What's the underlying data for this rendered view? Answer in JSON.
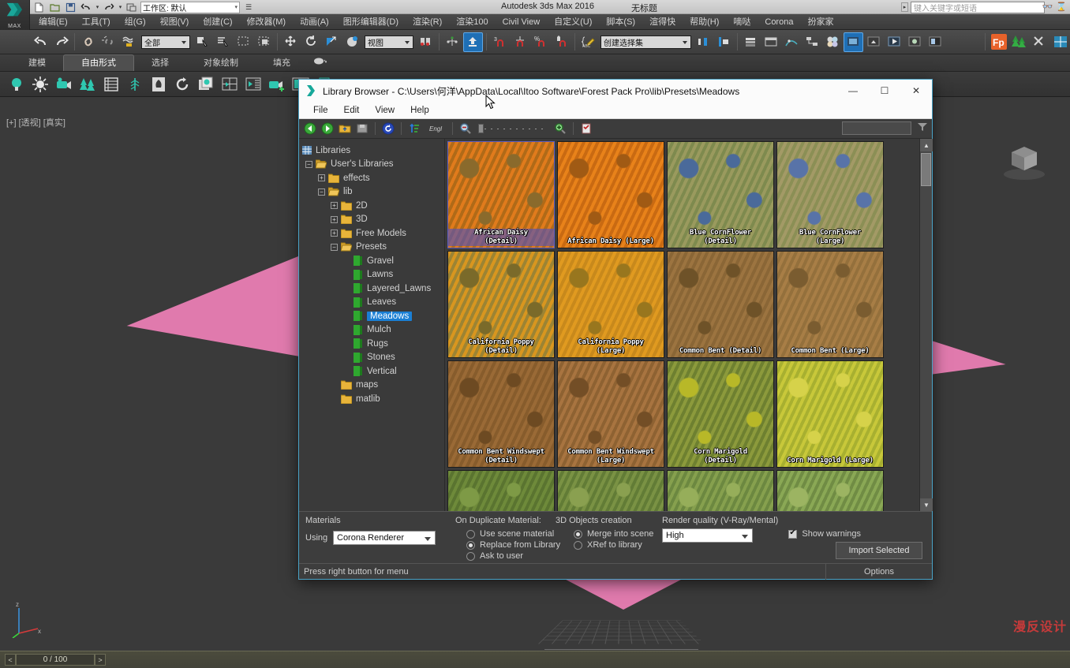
{
  "max": {
    "title": "Autodesk 3ds Max 2016",
    "document": "无标题",
    "workspace_label": "工作区: 默认",
    "search_placeholder": "键入关键字或短语",
    "menus": [
      "编辑(E)",
      "工具(T)",
      "组(G)",
      "视图(V)",
      "创建(C)",
      "修改器(M)",
      "动画(A)",
      "图形编辑器(D)",
      "渲染(R)",
      "渲染100",
      "Civil View",
      "自定义(U)",
      "脚本(S)",
      "渲得快",
      "帮助(H)",
      "嘀哒",
      "Corona",
      "扮家家"
    ],
    "toolbar_selection_filter": "全部",
    "toolbar_ref_coord": "视图",
    "toolbar_named_set": "创建选择集",
    "ribbon_tabs": [
      "建模",
      "自由形式",
      "选择",
      "对象绘制",
      "填充"
    ],
    "ribbon_selected": "自由形式",
    "viewport_label": "[+] [透视] [真实]",
    "frame_counter": "0 / 100",
    "prev_frame": "<",
    "next_frame": ">",
    "watermark": "漫反设计",
    "logo_text": "MAX",
    "axis_labels": {
      "z": "z",
      "x": "x",
      "y": "y"
    }
  },
  "library_browser": {
    "title": "Library Browser - C:\\Users\\何洋\\AppData\\Local\\Itoo Software\\Forest Pack Pro\\lib\\Presets\\Meadows",
    "window_buttons": {
      "minimize": "—",
      "maximize": "☐",
      "close": "✕"
    },
    "menus": [
      "File",
      "Edit",
      "View",
      "Help"
    ],
    "toolbar_icons": [
      "back-icon",
      "forward-icon",
      "folder-up-icon",
      "save-icon",
      "refresh-icon",
      "sort-icon",
      "language-icon",
      "zoom-out-icon",
      "zoom-slider",
      "zoom-in-icon",
      "checklist-icon"
    ],
    "language_badge": "Engl",
    "filter_value": "",
    "tree": {
      "root": "Libraries",
      "items": [
        {
          "label": "User's Libraries",
          "indent": 0,
          "expander": "-",
          "icon": "folder-open-icon"
        },
        {
          "label": "effects",
          "indent": 1,
          "expander": "+",
          "icon": "folder-icon"
        },
        {
          "label": "lib",
          "indent": 1,
          "expander": "-",
          "icon": "folder-open-icon"
        },
        {
          "label": "2D",
          "indent": 2,
          "expander": "+",
          "icon": "folder-icon"
        },
        {
          "label": "3D",
          "indent": 2,
          "expander": "+",
          "icon": "folder-icon"
        },
        {
          "label": "Free Models",
          "indent": 2,
          "expander": "+",
          "icon": "folder-icon"
        },
        {
          "label": "Presets",
          "indent": 2,
          "expander": "-",
          "icon": "folder-open-icon"
        },
        {
          "label": "Gravel",
          "indent": 3,
          "expander": "",
          "icon": "green-item-icon"
        },
        {
          "label": "Lawns",
          "indent": 3,
          "expander": "",
          "icon": "green-item-icon"
        },
        {
          "label": "Layered_Lawns",
          "indent": 3,
          "expander": "",
          "icon": "green-item-icon"
        },
        {
          "label": "Leaves",
          "indent": 3,
          "expander": "",
          "icon": "green-item-icon"
        },
        {
          "label": "Meadows",
          "indent": 3,
          "expander": "",
          "icon": "green-item-icon",
          "selected": true
        },
        {
          "label": "Mulch",
          "indent": 3,
          "expander": "",
          "icon": "green-item-icon"
        },
        {
          "label": "Rugs",
          "indent": 3,
          "expander": "",
          "icon": "green-item-icon"
        },
        {
          "label": "Stones",
          "indent": 3,
          "expander": "",
          "icon": "green-item-icon"
        },
        {
          "label": "Vertical",
          "indent": 3,
          "expander": "",
          "icon": "green-item-icon"
        },
        {
          "label": "maps",
          "indent": 2,
          "expander": "",
          "icon": "folder-icon"
        },
        {
          "label": "matlib",
          "indent": 2,
          "expander": "",
          "icon": "folder-icon"
        }
      ]
    },
    "thumbnails": [
      {
        "label": "African Daisy\n(Detail)",
        "c1": "#e07b1c",
        "c2": "#b06a18",
        "c3": "#8a6a2c",
        "selected": true
      },
      {
        "label": "African Daisy (Large)",
        "c1": "#e8821a",
        "c2": "#c96a12",
        "c3": "#a05a14",
        "selected": false
      },
      {
        "label": "Blue CornFlower\n(Detail)",
        "c1": "#9a9a5e",
        "c2": "#7e8a4e",
        "c3": "#4a6a9a",
        "selected": false
      },
      {
        "label": "Blue CornFlower\n(Large)",
        "c1": "#a39a66",
        "c2": "#8b8f55",
        "c3": "#5873a8",
        "selected": false
      },
      {
        "label": "California Poppy\n(Detail)",
        "c1": "#d8961f",
        "c2": "#9c8434",
        "c3": "#7a6a2a",
        "selected": false
      },
      {
        "label": "California Poppy\n(Large)",
        "c1": "#e09a20",
        "c2": "#c8891c",
        "c3": "#98761e",
        "selected": false
      },
      {
        "label": "Common Bent (Detail)",
        "c1": "#9c7440",
        "c2": "#8a6636",
        "c3": "#6e5228",
        "selected": false
      },
      {
        "label": "Common Bent (Large)",
        "c1": "#a87e46",
        "c2": "#94703c",
        "c3": "#7a5c30",
        "selected": false
      },
      {
        "label": "Common Bent Windswept\n(Detail)",
        "c1": "#9a6a36",
        "c2": "#875c2c",
        "c3": "#6d4a22",
        "selected": false
      },
      {
        "label": "Common Bent Windswept\n(Large)",
        "c1": "#a87440",
        "c2": "#8e6232",
        "c3": "#734e26",
        "selected": false
      },
      {
        "label": "Corn Marigold\n(Detail)",
        "c1": "#8c9a3c",
        "c2": "#6e8030",
        "c3": "#b8b828",
        "selected": false
      },
      {
        "label": "Corn Marigold (Large)",
        "c1": "#c8c83a",
        "c2": "#a8b030",
        "c3": "#d6d24a",
        "selected": false
      },
      {
        "label": "",
        "c1": "#6e8a3a",
        "c2": "#5a7430",
        "c3": "#7e9a46",
        "selected": false
      },
      {
        "label": "",
        "c1": "#7a9244",
        "c2": "#627c36",
        "c3": "#8aa050",
        "selected": false
      },
      {
        "label": "",
        "c1": "#86a04e",
        "c2": "#6c8840",
        "c3": "#96ae5a",
        "selected": false
      },
      {
        "label": "",
        "c1": "#8aa855",
        "c2": "#708c44",
        "c3": "#9cb462",
        "selected": false
      }
    ],
    "options": {
      "materials_label": "Materials",
      "using_label": "Using",
      "renderer_value": "Corona Renderer",
      "duplicate_label": "On Duplicate Material:",
      "duplicate_options": [
        {
          "label": "Use scene material",
          "selected": false
        },
        {
          "label": "Replace from Library",
          "selected": true
        },
        {
          "label": "Ask to user",
          "selected": false
        }
      ],
      "objects_label": "3D Objects creation",
      "objects_options": [
        {
          "label": "Merge into scene",
          "selected": true
        },
        {
          "label": "XRef to library",
          "selected": false
        }
      ],
      "quality_label": "Render quality (V-Ray/Mental)",
      "quality_value": "High",
      "show_warnings_label": "Show warnings",
      "show_warnings_checked": true,
      "import_button": "Import Selected"
    },
    "status": {
      "message": "Press right button for menu",
      "options_label": "Options"
    }
  },
  "colors": {
    "accent_blue": "#1a7fd4",
    "window_border": "#4aa3c7",
    "pink": "#e07aad",
    "forest_orange": "#e8622a"
  }
}
